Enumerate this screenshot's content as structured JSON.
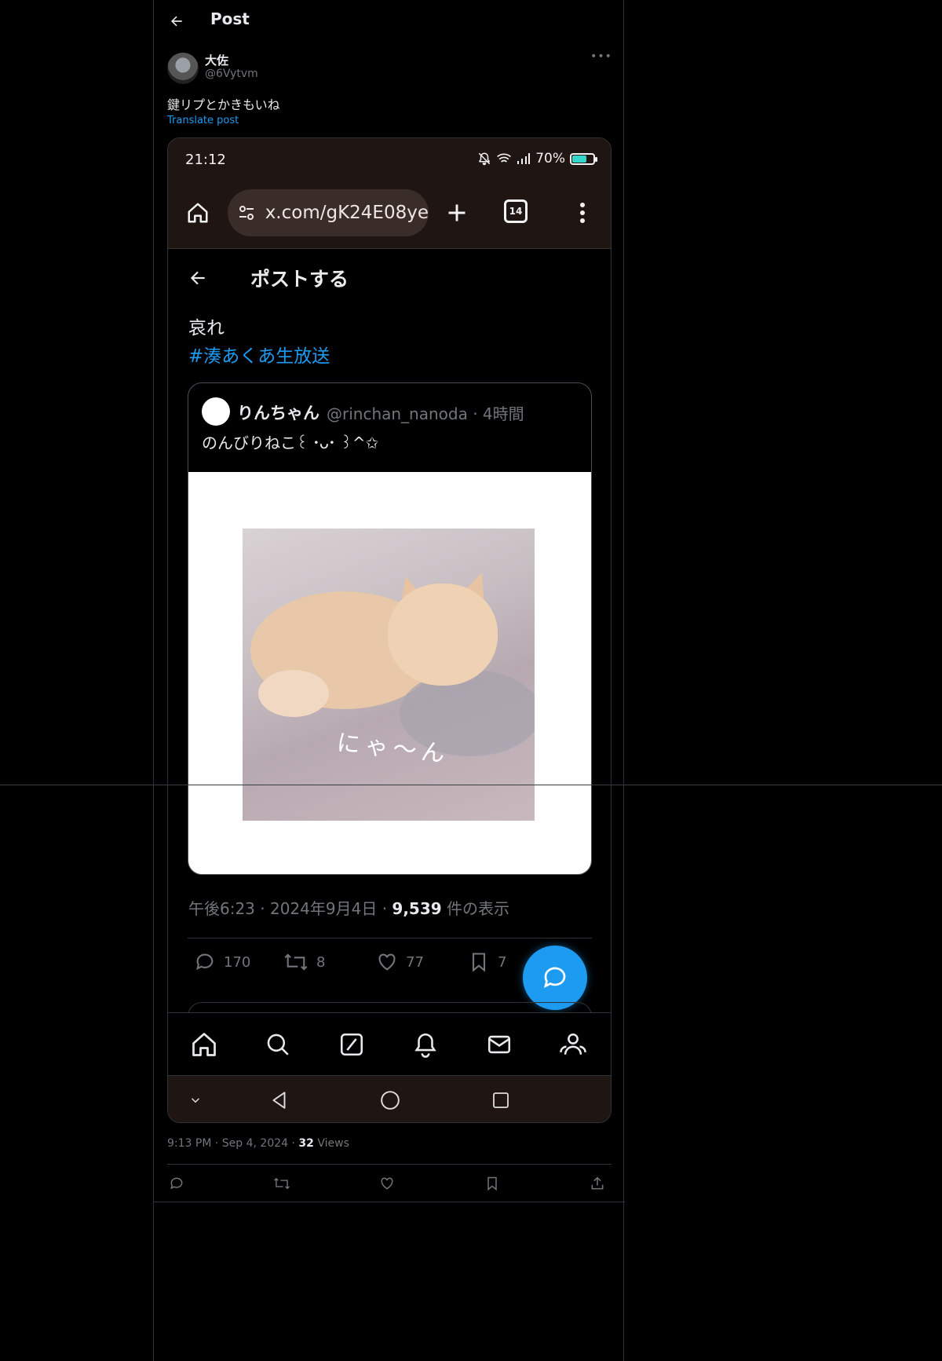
{
  "header": {
    "title": "Post"
  },
  "post": {
    "author_name": "大佐",
    "author_handle": "@6Vytvm",
    "text": "鍵リプとかきもいね",
    "translate_label": "Translate post",
    "timestamp": "9:13 PM",
    "date": "Sep 4, 2024",
    "views_count": "32",
    "views_label": "Views"
  },
  "screenshot": {
    "status_time": "21:12",
    "battery": "70%",
    "battery_level": 0.7,
    "url": "x.com/gK24E08ye",
    "tab_count": "14",
    "page_title": "ポストする",
    "text": "哀れ",
    "hashtag": "#湊あくあ生放送",
    "quote": {
      "name": "りんちゃん",
      "meta": "@rinchan_nanoda · 4時間",
      "text": "のんびりねこ꒰ ･ᴗ･ ꒱^✩",
      "image_caption": "にゃ～ん"
    },
    "post_time": "午後6:23 · 2024年9月4日 · ",
    "views_count": "9,539",
    "views_label": " 件の表示",
    "actions": {
      "replies": "170",
      "reposts": "8",
      "likes": "77",
      "bookmarks": "7"
    }
  },
  "colors": {
    "accent": "#1d9bf0",
    "background": "#000000",
    "muted": "#71767b"
  }
}
